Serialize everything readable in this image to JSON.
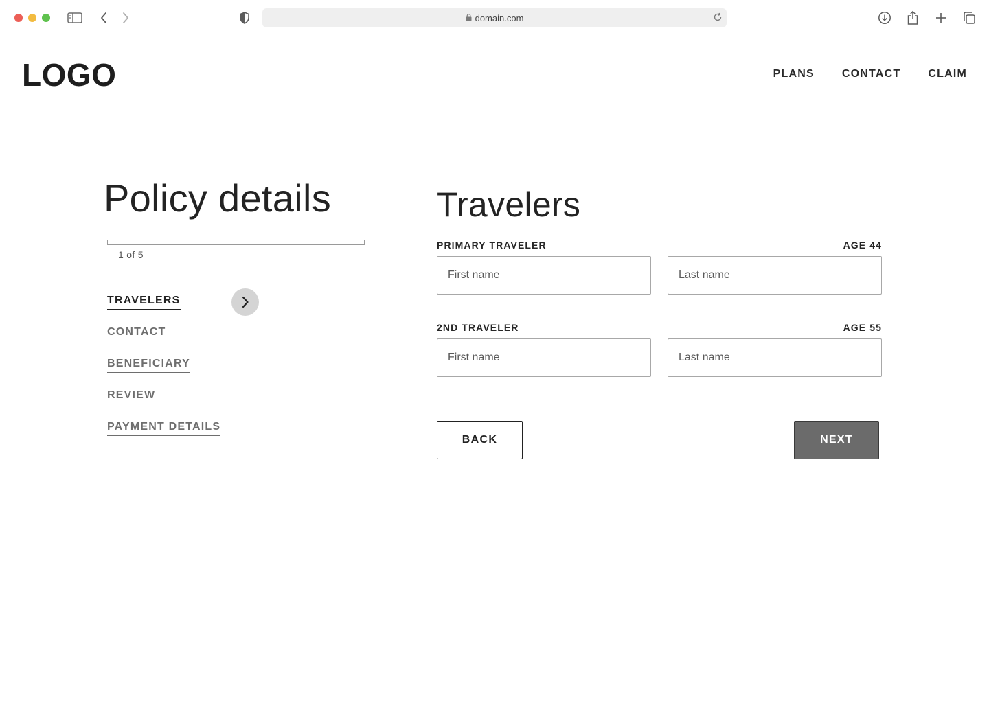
{
  "browser": {
    "url": "domain.com",
    "icons": [
      "sidebar-icon",
      "back-icon",
      "forward-icon",
      "shield-icon",
      "lock-icon",
      "reload-icon",
      "download-icon",
      "share-icon",
      "new-tab-icon",
      "tabs-overview-icon"
    ]
  },
  "header": {
    "logo": "LOGO",
    "nav": [
      {
        "label": "PLANS"
      },
      {
        "label": "CONTACT"
      },
      {
        "label": "CLAIM"
      }
    ]
  },
  "sidebar": {
    "title": "Policy details",
    "progress": {
      "current": 1,
      "total": 5,
      "text": "1 of 5",
      "fraction": 0
    },
    "steps": [
      {
        "label": "TRAVELERS",
        "active": true
      },
      {
        "label": "CONTACT",
        "active": false
      },
      {
        "label": "BENEFICIARY",
        "active": false
      },
      {
        "label": "REVIEW",
        "active": false
      },
      {
        "label": "PAYMENT DETAILS",
        "active": false
      }
    ],
    "arrow_icon": "chevron-right-icon"
  },
  "main": {
    "title": "Travelers",
    "travelers": [
      {
        "label": "PRIMARY TRAVELER",
        "age": "AGE 44",
        "first_name": {
          "value": "",
          "placeholder": "First name"
        },
        "last_name": {
          "value": "",
          "placeholder": "Last name"
        }
      },
      {
        "label": "2ND TRAVELER",
        "age": "AGE 55",
        "first_name": {
          "value": "",
          "placeholder": "First name"
        },
        "last_name": {
          "value": "",
          "placeholder": "Last name"
        }
      }
    ],
    "back_label": "BACK",
    "next_label": "NEXT"
  },
  "colors": {
    "next_button": "#6b6b6b",
    "step_arrow": "#d4d4d4",
    "active_step": "#222222",
    "inactive_step": "#6e6e6e"
  }
}
